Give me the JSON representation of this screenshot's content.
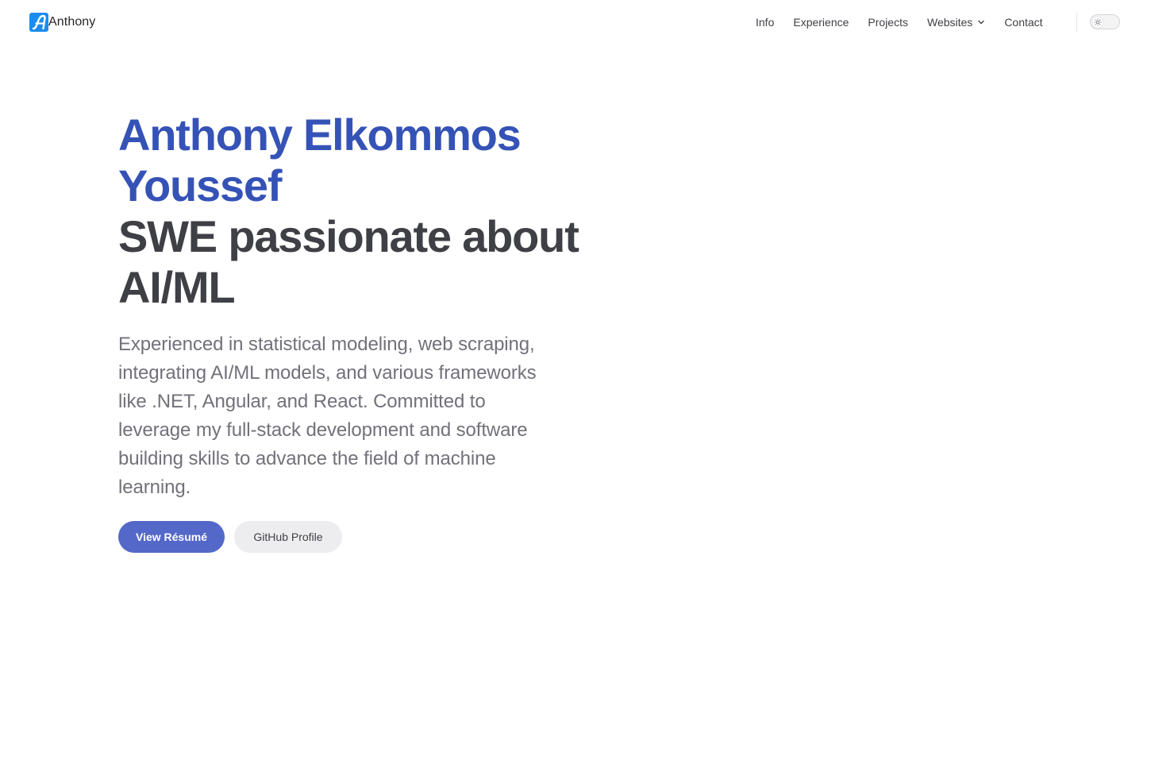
{
  "header": {
    "brand": {
      "logo_icon": "stylized-letter-a-logo",
      "logo_color": "#1a8cf0",
      "name": "Anthony"
    },
    "nav": {
      "items": [
        {
          "label": "Info"
        },
        {
          "label": "Experience"
        },
        {
          "label": "Projects"
        },
        {
          "label": "Websites",
          "icon": "chevron-down-icon"
        },
        {
          "label": "Contact"
        }
      ]
    },
    "theme_toggle": {
      "icon": "sun-icon"
    }
  },
  "hero": {
    "name": "Anthony Elkommos Youssef",
    "tagline": "SWE passionate about AI/ML",
    "description": "Experienced in statistical modeling, web scraping, integrating AI/ML models, and various frameworks like .NET, Angular, and React. Committed to leverage my full-stack development and software building skills to advance the field of machine learning.",
    "buttons": {
      "primary": "View Résumé",
      "secondary": "GitHub Profile"
    }
  },
  "colors": {
    "accent": "#3552b6",
    "primary_button": "#5468c9",
    "secondary_button": "#ededf0",
    "text": "#3f3f46",
    "muted_text": "#71717a"
  }
}
